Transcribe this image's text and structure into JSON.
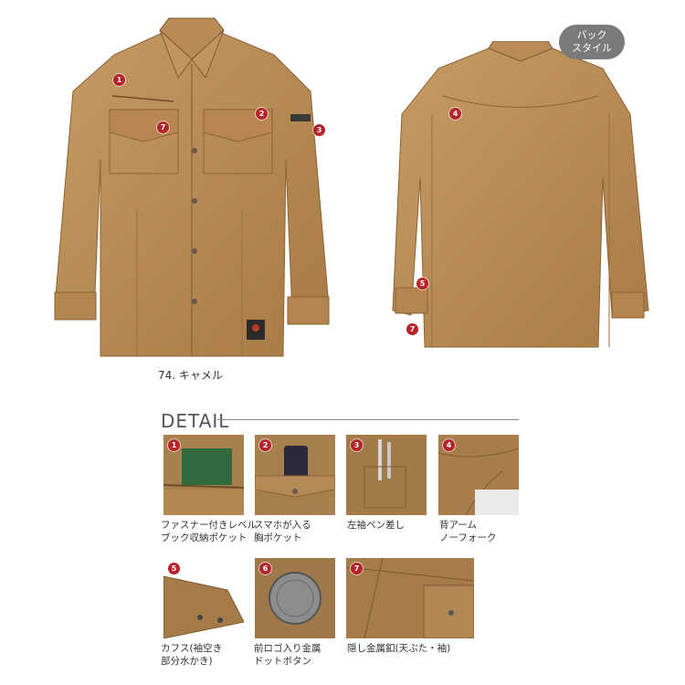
{
  "back_style_label_line1": "バック",
  "back_style_label_line2": "スタイル",
  "color_caption": "74. キャメル",
  "detail_heading": "DETAIL",
  "product_color": "#b98b55",
  "badge_color": "#b5242a",
  "front_badges": [
    "1",
    "2",
    "3",
    "7"
  ],
  "back_badges": [
    "4",
    "5",
    "7"
  ],
  "details": [
    {
      "num": "1",
      "line1": "ファスナー付きレベル",
      "line2": "ブック収納ポケット"
    },
    {
      "num": "2",
      "line1": "スマホが入る",
      "line2": "胸ポケット"
    },
    {
      "num": "3",
      "line1": "左袖ペン差し",
      "line2": ""
    },
    {
      "num": "4",
      "line1": "背アーム",
      "line2": "ノーフォーク"
    },
    {
      "num": "5",
      "line1": "カフス(袖空き",
      "line2": "部分水かき)"
    },
    {
      "num": "6",
      "line1": "前ロゴ入り金属",
      "line2": "ドットボタン"
    },
    {
      "num": "7",
      "line1": "隠し金属釦(天ぶた・袖)",
      "line2": ""
    }
  ]
}
